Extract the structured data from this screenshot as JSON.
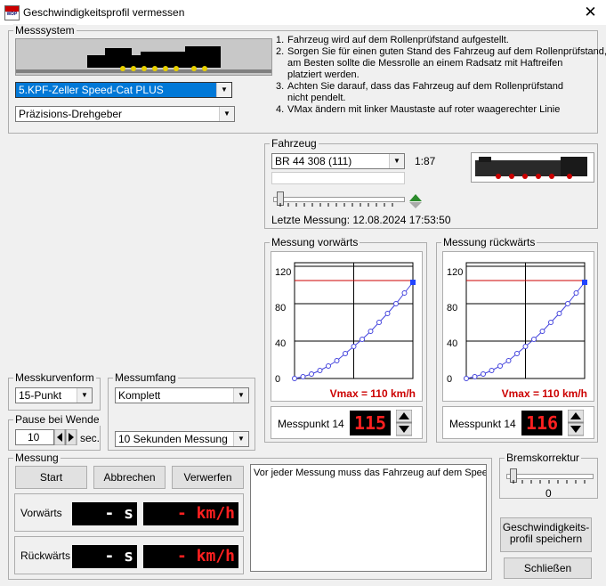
{
  "window": {
    "title": "Geschwindigkeitsprofil vermessen",
    "close_label": "✕",
    "icon_text": "WDP"
  },
  "messsystem": {
    "label": "Messsystem",
    "device": "5.KPF-Zeller Speed-Cat PLUS",
    "encoder": "Präzisions-Drehgeber",
    "instructions": [
      {
        "num": "1.",
        "text": "Fahrzeug wird auf dem Rollenprüfstand aufgestellt."
      },
      {
        "num": "2.",
        "text": "Sorgen Sie für einen guten Stand des Fahrzeug auf dem Rollenprüfstand,"
      },
      {
        "num": "",
        "text": "am Besten sollte die Messrolle an einem Radsatz mit Haftreifen"
      },
      {
        "num": "",
        "text": "platziert werden."
      },
      {
        "num": "3.",
        "text": "Achten Sie darauf, dass das Fahrzeug auf dem Rollenprüfstand"
      },
      {
        "num": "",
        "text": "nicht pendelt."
      },
      {
        "num": "4.",
        "text": "VMax ändern mit linker Maustaste auf roter waagerechter Linie"
      }
    ]
  },
  "fahrzeug": {
    "label": "Fahrzeug",
    "vehicle": "BR 44 308 (111)",
    "scale": "1:87",
    "last_measurement": "Letzte Messung: 12.08.2024 17:53:50"
  },
  "messkurvenform": {
    "label": "Messkurvenform",
    "value": "15-Punkt"
  },
  "messumfang": {
    "label": "Messumfang",
    "value": "Komplett",
    "duration": "10 Sekunden Messung"
  },
  "pause": {
    "label": "Pause bei Wende",
    "value": "10",
    "unit": "sec."
  },
  "chart_data": [
    {
      "type": "line",
      "title": "Messung vorwärts",
      "x": [
        0,
        1,
        2,
        3,
        4,
        5,
        6,
        7,
        8,
        9,
        10,
        11,
        12,
        13,
        14
      ],
      "values": [
        0,
        2,
        5,
        9,
        14,
        20,
        28,
        36,
        44,
        53,
        63,
        73,
        84,
        96,
        108
      ],
      "yticks": [
        0,
        40,
        80,
        120
      ],
      "ylim": [
        0,
        130
      ],
      "vmax": 110,
      "vmax_label": "Vmax = 110 km/h",
      "point_label": "Messpunkt 14",
      "point_value": "115",
      "colors": {
        "curve": "#4444dd",
        "vmax": "#cc0000"
      }
    },
    {
      "type": "line",
      "title": "Messung rückwärts",
      "x": [
        0,
        1,
        2,
        3,
        4,
        5,
        6,
        7,
        8,
        9,
        10,
        11,
        12,
        13,
        14
      ],
      "values": [
        0,
        2,
        5,
        9,
        14,
        20,
        28,
        36,
        44,
        53,
        63,
        73,
        84,
        96,
        108
      ],
      "yticks": [
        0,
        40,
        80,
        120
      ],
      "ylim": [
        0,
        130
      ],
      "vmax": 110,
      "vmax_label": "Vmax = 110 km/h",
      "point_label": "Messpunkt 14",
      "point_value": "116",
      "colors": {
        "curve": "#4444dd",
        "vmax": "#cc0000"
      }
    }
  ],
  "messung": {
    "label": "Messung",
    "start": "Start",
    "abbrechen": "Abbrechen",
    "verwerfen": "Verwerfen",
    "vorwaerts_label": "Vorwärts",
    "rueckwaerts_label": "Rückwärts",
    "time_display": "- s",
    "speed_display": "- km/h",
    "log_text": "Vor jeder Messung muss das Fahrzeug auf dem Speed-Cat"
  },
  "bremskorrektur": {
    "label": "Bremskorrektur",
    "value": "0"
  },
  "buttons": {
    "save": "Geschwindigkeits-profil speichern",
    "close": "Schließen"
  },
  "colors": {
    "display_bg": "#000000",
    "display_red": "#ff2020",
    "display_white": "#ffffff",
    "vmax_text": "#cc0000"
  }
}
